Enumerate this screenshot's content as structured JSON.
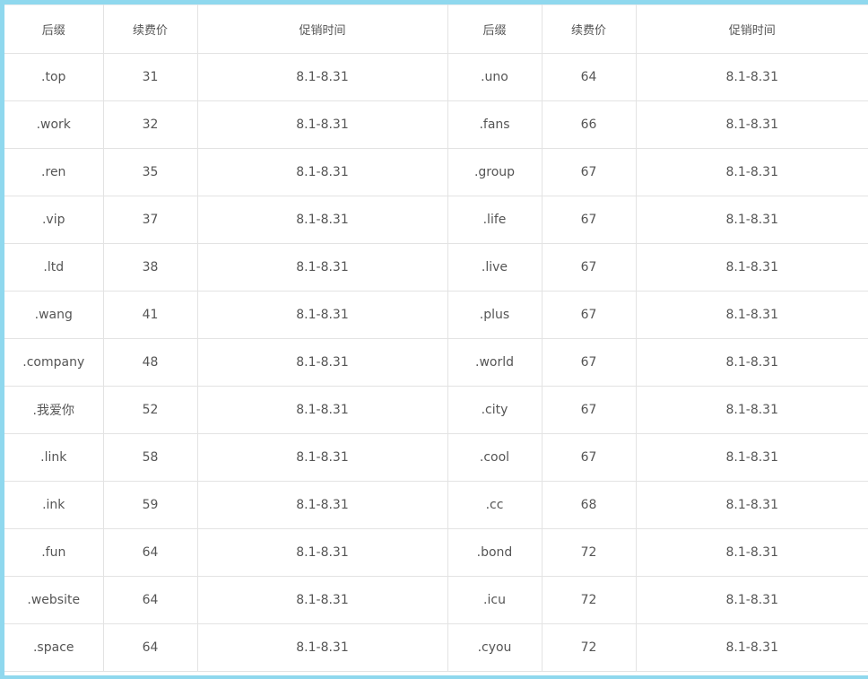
{
  "table": {
    "headers": [
      "后缀",
      "续费价",
      "促销时间",
      "后缀",
      "续费价",
      "促销时间"
    ],
    "rows": [
      [
        ".top",
        "31",
        "8.1-8.31",
        ".uno",
        "64",
        "8.1-8.31"
      ],
      [
        ".work",
        "32",
        "8.1-8.31",
        ".fans",
        "66",
        "8.1-8.31"
      ],
      [
        ".ren",
        "35",
        "8.1-8.31",
        ".group",
        "67",
        "8.1-8.31"
      ],
      [
        ".vip",
        "37",
        "8.1-8.31",
        ".life",
        "67",
        "8.1-8.31"
      ],
      [
        ".ltd",
        "38",
        "8.1-8.31",
        ".live",
        "67",
        "8.1-8.31"
      ],
      [
        ".wang",
        "41",
        "8.1-8.31",
        ".plus",
        "67",
        "8.1-8.31"
      ],
      [
        ".company",
        "48",
        "8.1-8.31",
        ".world",
        "67",
        "8.1-8.31"
      ],
      [
        ".我爱你",
        "52",
        "8.1-8.31",
        ".city",
        "67",
        "8.1-8.31"
      ],
      [
        ".link",
        "58",
        "8.1-8.31",
        ".cool",
        "67",
        "8.1-8.31"
      ],
      [
        ".ink",
        "59",
        "8.1-8.31",
        ".cc",
        "68",
        "8.1-8.31"
      ],
      [
        ".fun",
        "64",
        "8.1-8.31",
        ".bond",
        "72",
        "8.1-8.31"
      ],
      [
        ".website",
        "64",
        "8.1-8.31",
        ".icu",
        "72",
        "8.1-8.31"
      ],
      [
        ".space",
        "64",
        "8.1-8.31",
        ".cyou",
        "72",
        "8.1-8.31"
      ]
    ]
  },
  "colors": {
    "page_border": "#8fd8ee",
    "cell_border": "#e3e3e3",
    "text": "#555555",
    "background": "#ffffff"
  }
}
